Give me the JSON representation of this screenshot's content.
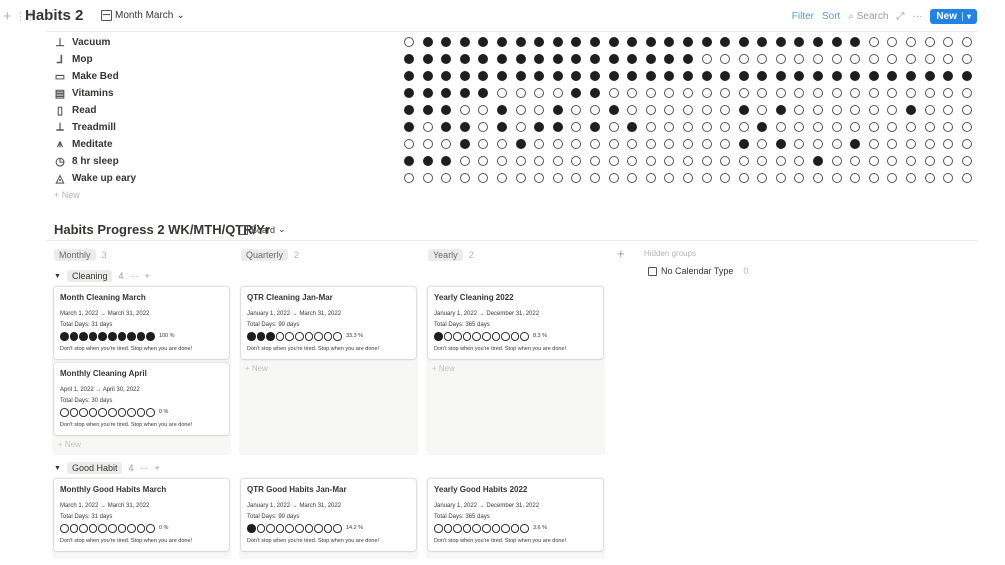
{
  "database": {
    "title": "Habits 2",
    "view_label": "Month March",
    "filter_label": "Filter",
    "sort_label": "Sort",
    "search_label": "Search",
    "more_label": "···",
    "new_label": "New"
  },
  "habits": [
    {
      "name": "Vacuum",
      "icon": "vacuum-icon",
      "days": "0111111111111111111111111000000"
    },
    {
      "name": "Mop",
      "icon": "mop-icon",
      "days": "1111111111111111000000000000000"
    },
    {
      "name": "Make Bed",
      "icon": "bed-icon",
      "days": "1111111111111111111111111111111"
    },
    {
      "name": "Vitamins",
      "icon": "pill-bottle-icon",
      "days": "1111100001100000000000000000000"
    },
    {
      "name": "Read",
      "icon": "book-icon",
      "days": "1110010010010000001010000001000"
    },
    {
      "name": "Treadmill",
      "icon": "treadmill-icon",
      "days": "1011010110101000000100000000000"
    },
    {
      "name": "Meditate",
      "icon": "meditate-icon",
      "days": "0001001000000000001010001000000"
    },
    {
      "name": "8 hr sleep",
      "icon": "clock-icon",
      "days": "1110000000000000000000100000000"
    },
    {
      "name": "Wake up eary",
      "icon": "sunrise-icon",
      "days": "0000000000000000000000000000000"
    }
  ],
  "habits_new_label": "+ New",
  "board": {
    "title": "Habits Progress 2 WK/MTH/QTR/Yr",
    "view_label": "Board",
    "columns": [
      {
        "label": "Monthly",
        "count": "3"
      },
      {
        "label": "Quarterly",
        "count": "2"
      },
      {
        "label": "Yearly",
        "count": "2"
      }
    ],
    "hidden_groups_label": "Hidden groups",
    "no_calendar_label": "No Calendar Type",
    "no_calendar_count": "0",
    "new_label": "+ New",
    "groups": [
      {
        "label": "Cleaning",
        "count": "4",
        "cards": [
          {
            "title": "Month Cleaning March",
            "date": "March 1, 2022 → March 31, 2022",
            "total": "Total Days: 31 days",
            "filled": 10,
            "pct": "100 %",
            "msg": "Don't stop when you're tired. Stop when you are done!"
          },
          {
            "title": "QTR Cleaning Jan-Mar",
            "date": "January 1, 2022 → March 31, 2022",
            "total": "Total Days: 90 days",
            "filled": 3,
            "pct": "33.3 %",
            "msg": "Don't stop when you're tired. Stop when you are done!"
          },
          {
            "title": "Yearly Cleaning 2022",
            "date": "January 1, 2022 → December 31, 2022",
            "total": "Total Days: 365 days",
            "filled": 1,
            "pct": "8.3 %",
            "msg": "Don't stop when you're tired. Stop when you are done!"
          },
          {
            "title": "Monthly Cleaning April",
            "date": "April 1, 2022 → April 30, 2022",
            "total": "Total Days: 30 days",
            "filled": 0,
            "pct": "0 %",
            "msg": "Don't stop when you're tired. Stop when you are done!"
          }
        ]
      },
      {
        "label": "Good Habit",
        "count": "4",
        "cards": [
          {
            "title": "Monthly Good Habits March",
            "date": "March 1, 2022 → March 31, 2022",
            "total": "Total Days: 31 days",
            "filled": 0,
            "pct": "0 %",
            "msg": "Don't stop when you're tired. Stop when you are done!"
          },
          {
            "title": "QTR Good Habits Jan-Mar",
            "date": "January 1, 2022 → March 31, 2022",
            "total": "Total Days: 90 days",
            "filled": 1,
            "pct": "14.2 %",
            "msg": "Don't stop when you're tired. Stop when you are done!"
          },
          {
            "title": "Yearly Good Habits 2022",
            "date": "January 1, 2022 → December 31, 2022",
            "total": "Total Days: 365 days",
            "filled": 0,
            "pct": "3.6 %",
            "msg": "Don't stop when you're tired. Stop when you are done!"
          }
        ]
      }
    ]
  }
}
